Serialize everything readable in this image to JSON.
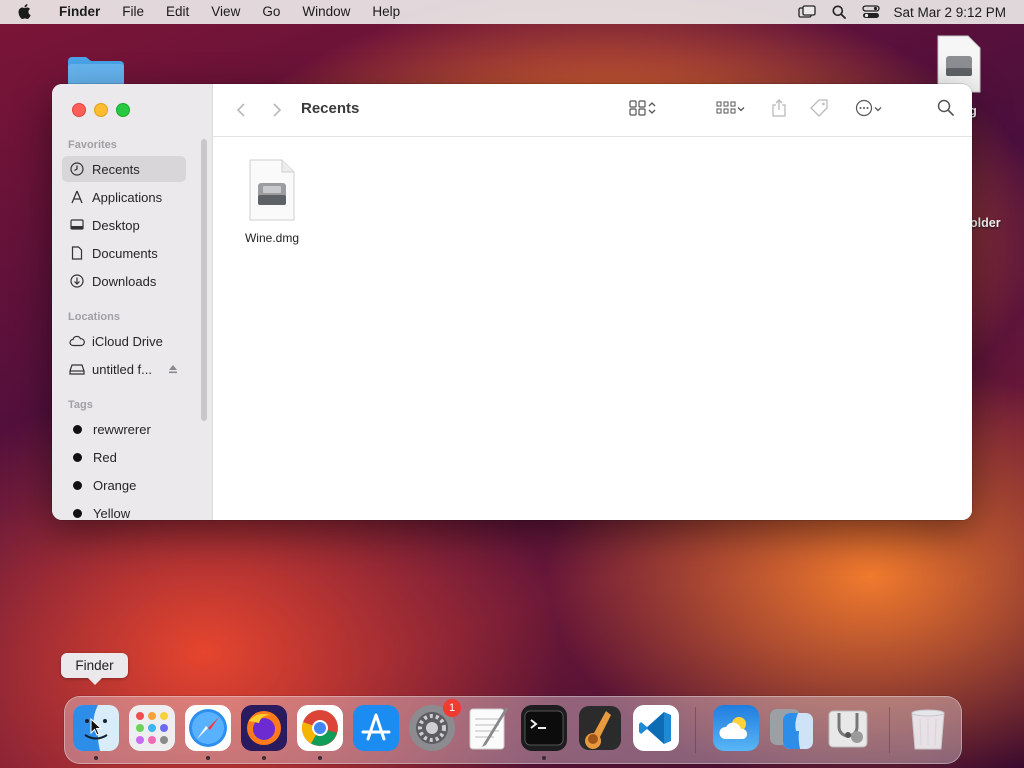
{
  "menubar": {
    "app_name": "Finder",
    "menus": [
      "File",
      "Edit",
      "View",
      "Go",
      "Window",
      "Help"
    ],
    "clock": "Sat Mar 2  9:12 PM"
  },
  "desktop": {
    "dmg_label_partial": "mg",
    "folder_label_partial": "older"
  },
  "finder": {
    "title": "Recents",
    "sidebar": {
      "favorites_header": "Favorites",
      "favorites": [
        {
          "label": "Recents",
          "icon": "clock-icon",
          "selected": true
        },
        {
          "label": "Applications",
          "icon": "applications-icon"
        },
        {
          "label": "Desktop",
          "icon": "desktop-icon"
        },
        {
          "label": "Documents",
          "icon": "document-icon"
        },
        {
          "label": "Downloads",
          "icon": "download-icon"
        }
      ],
      "locations_header": "Locations",
      "locations": [
        {
          "label": "iCloud Drive",
          "icon": "cloud-icon"
        },
        {
          "label": "untitled f...",
          "icon": "drive-icon"
        }
      ],
      "tags_header": "Tags",
      "tags": [
        {
          "label": "rewwrerer",
          "color": "#111111"
        },
        {
          "label": "Red",
          "color": "#111111"
        },
        {
          "label": "Orange",
          "color": "#111111"
        },
        {
          "label": "Yellow",
          "color": "#111111"
        }
      ]
    },
    "files": [
      {
        "name": "Wine.dmg",
        "icon": "dmg-file-icon"
      }
    ]
  },
  "tooltip": "Finder",
  "dock": {
    "apps": [
      "Finder",
      "Launchpad",
      "Safari",
      "Firefox",
      "Chrome",
      "App Store",
      "System Settings",
      "TextEdit",
      "Terminal",
      "GarageBand",
      "VS Code",
      "Weather",
      "Migration Assistant",
      "Disk Utility",
      "Trash"
    ],
    "settings_badge": "1"
  }
}
